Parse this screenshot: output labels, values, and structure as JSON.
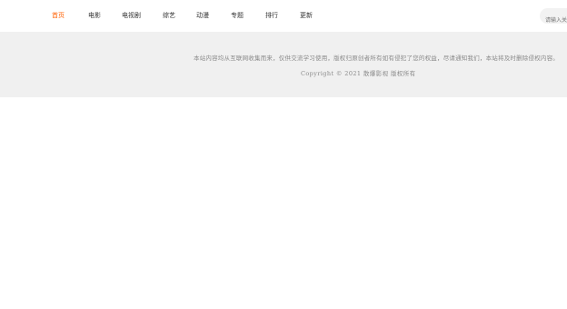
{
  "nav": {
    "items": [
      {
        "label": "首页",
        "active": true
      },
      {
        "label": "电影",
        "active": false
      },
      {
        "label": "电视剧",
        "active": false
      },
      {
        "label": "综艺",
        "active": false
      },
      {
        "label": "动漫",
        "active": false
      },
      {
        "label": "专题",
        "active": false
      },
      {
        "label": "排行",
        "active": false
      },
      {
        "label": "更新",
        "active": false
      }
    ],
    "accent_color": "#ff5f00"
  },
  "search": {
    "placeholder": "请输入关键词"
  },
  "footer": {
    "notice": "本站内容均从互联网收集而来，仅供交流学习使用，版权归原创者所有如有侵犯了您的权益，尽请通知我们，本站将及时删除侵权内容。",
    "copyright": "Copyright © 2021 散爆影视 版权所有"
  }
}
